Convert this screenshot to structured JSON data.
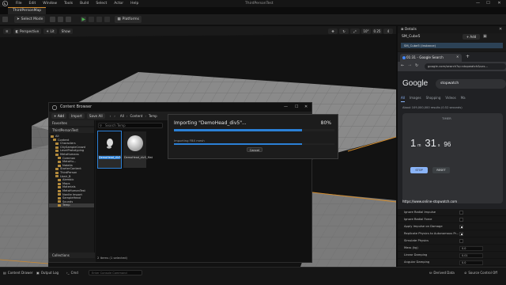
{
  "app": {
    "project_title": "ThirdPersonTest",
    "menu": [
      "File",
      "Edit",
      "Window",
      "Tools",
      "Build",
      "Select",
      "Actor",
      "Help"
    ],
    "window_controls": [
      "—",
      "☐",
      "✕"
    ]
  },
  "tabs": {
    "map_tab": "ThirdPersonMap"
  },
  "toolbar": {
    "select_mode": "Select Mode",
    "platforms": "Platforms"
  },
  "viewport": {
    "perspective": "Perspective",
    "lit": "Lit",
    "show": "Show",
    "right_controls": [
      "10°",
      "0.25",
      "4"
    ]
  },
  "content_browser": {
    "title": "Content Browser",
    "add": "+ Add",
    "import": "Import",
    "save_all": "Save All",
    "breadcrumb": [
      "All",
      "Content",
      "Temp"
    ],
    "favorites": "Favorites",
    "project_root": "ThirdPersonTest",
    "tree": [
      {
        "label": "All",
        "indent": 0
      },
      {
        "label": "Content",
        "indent": 1
      },
      {
        "label": "Characters",
        "indent": 2
      },
      {
        "label": "CitySampleCrowd",
        "indent": 2
      },
      {
        "label": "LevelPrototyping",
        "indent": 2
      },
      {
        "label": "MetaHumans",
        "indent": 2
      },
      {
        "label": "Common",
        "indent": 3
      },
      {
        "label": "MetaHu...",
        "indent": 3
      },
      {
        "label": "Natalia",
        "indent": 3
      },
      {
        "label": "StarterContent",
        "indent": 2
      },
      {
        "label": "ThirdPerson",
        "indent": 2
      },
      {
        "label": "Uzair_B",
        "indent": 2
      },
      {
        "label": "Alembic",
        "indent": 3
      },
      {
        "label": "Maps",
        "indent": 3
      },
      {
        "label": "Materials",
        "indent": 3
      },
      {
        "label": "MetaHumanTest",
        "indent": 3
      },
      {
        "label": "Nanite Import",
        "indent": 3
      },
      {
        "label": "SampleHead",
        "indent": 3
      },
      {
        "label": "Sounds",
        "indent": 3
      },
      {
        "label": "Temp",
        "indent": 3
      }
    ],
    "search_placeholder": "Search Temp",
    "assets": [
      {
        "label": "DemoHead_div5"
      },
      {
        "label": "DemoHead_div5_Mat"
      }
    ],
    "collections": "Collections",
    "status": "2 items (1 selected)"
  },
  "import_dialog": {
    "title": "Importing \"DemoHead_div5\"...",
    "percent": "80%",
    "progress": 0.8,
    "subtitle": "Importing FBX mesh",
    "sub_progress": 0.8,
    "cancel": "Cancel"
  },
  "details": {
    "tab": "Details",
    "object_name": "SM_Cube5",
    "add": "+ Add",
    "instance": "SM_Cube5 (Instance)",
    "properties": [
      {
        "label": "Ignore Radial Impulse",
        "kind": "checkbox",
        "checked": false
      },
      {
        "label": "Ignore Radial Force",
        "kind": "checkbox",
        "checked": false
      },
      {
        "label": "Apply Impulse on Damage",
        "kind": "checkbox",
        "checked": true
      },
      {
        "label": "Replicate Physics to Autonomous Pr...",
        "kind": "checkbox",
        "checked": true
      },
      {
        "label": "Simulate Physics",
        "kind": "checkbox",
        "checked": false
      },
      {
        "label": "Mass (kg)",
        "kind": "value",
        "value": "0.0"
      },
      {
        "label": "Linear Damping",
        "kind": "value",
        "value": "0.01"
      },
      {
        "label": "Angular Damping",
        "kind": "value",
        "value": "0.0"
      }
    ]
  },
  "chrome": {
    "tab_title": "01:31 - Google Search",
    "url": "google.com/search?q=stopwatch&sxs...",
    "logo": "Google",
    "query": "stopwatch",
    "search_tabs": [
      "All",
      "Images",
      "Shopping",
      "Videos",
      "Ma"
    ],
    "result_count": "About 109,000,000 results (0.52 seconds)",
    "timer_label": "TIMER",
    "minutes": "1",
    "minutes_unit": "m",
    "seconds": "31",
    "seconds_unit": "s",
    "centis": "96",
    "stop": "STOP",
    "reset": "RESET",
    "link": "https://www.online-stopwatch.com"
  },
  "statusbar": {
    "content_drawer": "Content Drawer",
    "output_log": "Output Log",
    "cmd": "Cmd",
    "cmd_placeholder": "Enter Console Command",
    "derived_data": "Derived Data",
    "source_control": "Source Control Off"
  },
  "colors": {
    "accent_orange": "#d08a2c",
    "progress_blue": "#2b80d6",
    "viewport_mesh": "#7a7a7a"
  }
}
